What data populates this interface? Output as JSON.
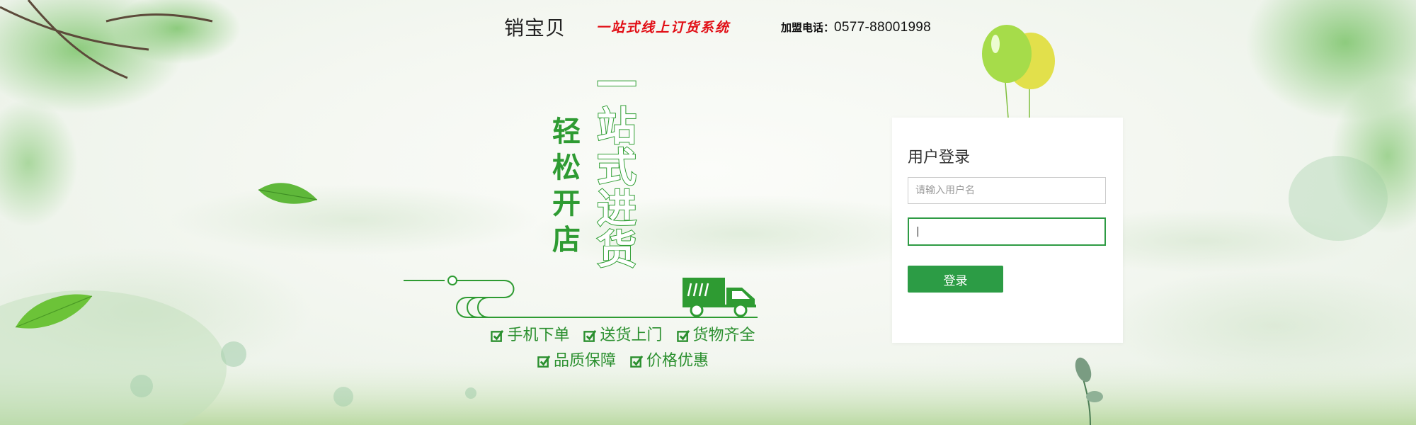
{
  "header": {
    "brand": "销宝贝",
    "slogan": "一站式线上订货系统",
    "phone_label": "加盟电话：",
    "phone_number": "0577-88001998"
  },
  "hero": {
    "headline_vertical": [
      "一",
      "站",
      "式",
      "进",
      "货"
    ],
    "subline_vertical": [
      "轻",
      "松",
      "开",
      "店"
    ],
    "features": [
      [
        "手机下单",
        "送货上门",
        "货物齐全"
      ],
      [
        "品质保障",
        "价格优惠"
      ]
    ]
  },
  "login": {
    "title": "用户登录",
    "username_placeholder": "请输入用户名",
    "password_value": "|",
    "submit_label": "登录"
  },
  "colors": {
    "accent_green": "#2c9c45",
    "slogan_red": "#e10e15",
    "balloon_green": "#a6dc4a",
    "balloon_yellow": "#e4e24a"
  },
  "icons": {
    "check": "checkbox-checked-icon",
    "truck": "truck-icon",
    "balloons": "balloons-icon",
    "leaf": "leaf-icon"
  }
}
